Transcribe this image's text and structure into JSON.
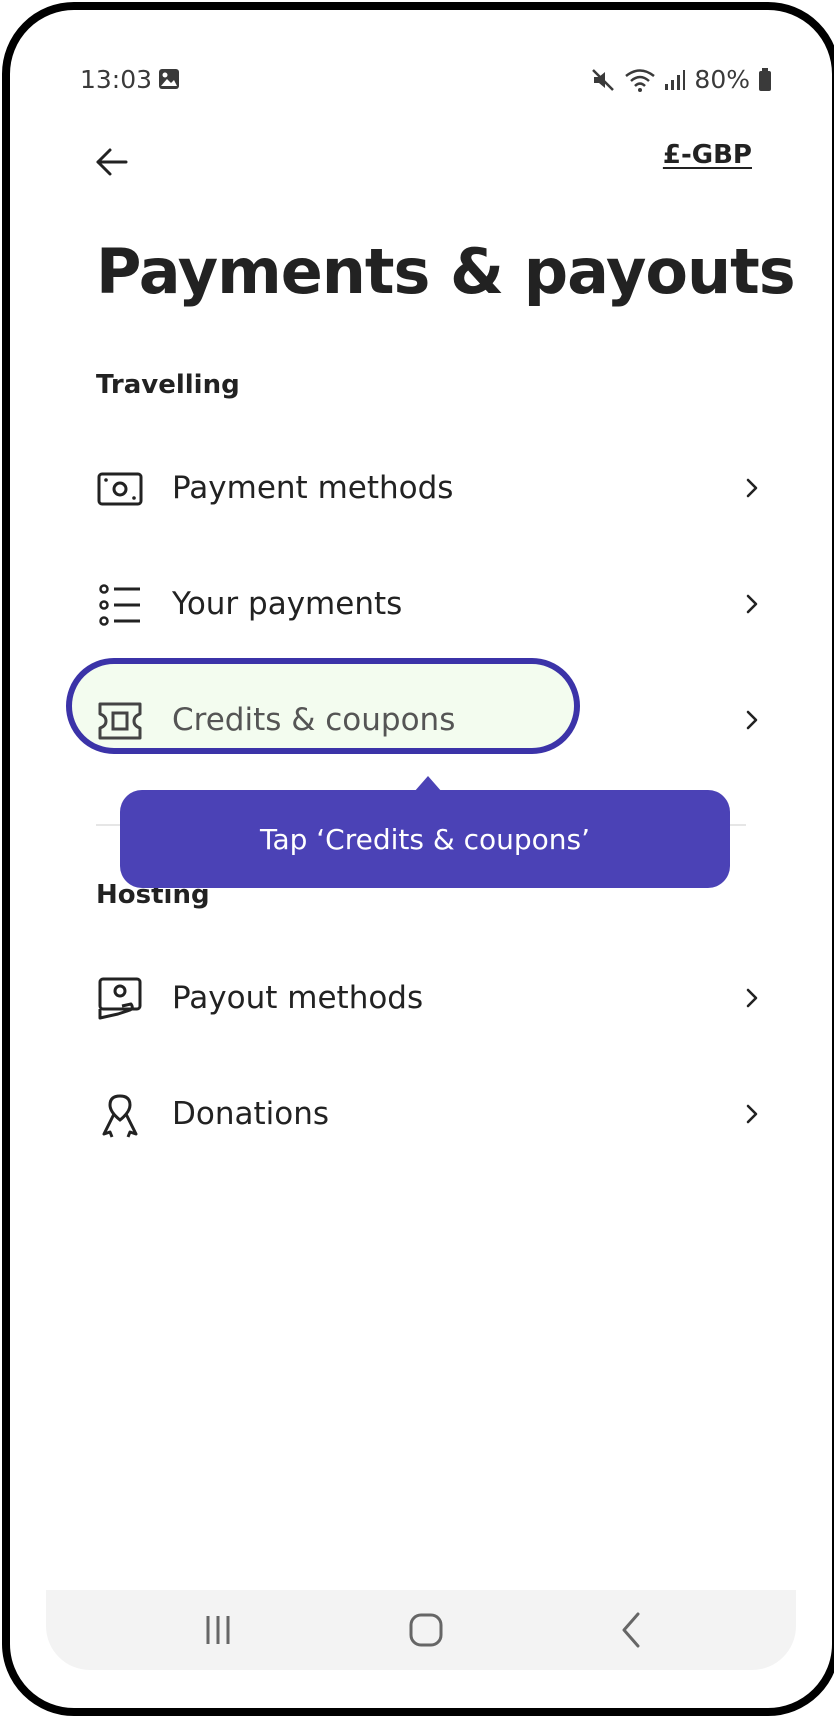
{
  "status_bar": {
    "time": "13:03",
    "battery": "80%"
  },
  "header": {
    "currency": "£-GBP"
  },
  "page": {
    "title": "Payments & payouts"
  },
  "sections": {
    "travelling": {
      "label": "Travelling",
      "items": [
        {
          "label": "Payment methods",
          "icon": "banknote-icon"
        },
        {
          "label": "Your payments",
          "icon": "list-icon"
        },
        {
          "label": "Credits & coupons",
          "icon": "ticket-icon"
        }
      ]
    },
    "hosting": {
      "label": "Hosting",
      "items": [
        {
          "label": "Payout methods",
          "icon": "hand-cash-icon"
        },
        {
          "label": "Donations",
          "icon": "ribbon-icon"
        }
      ]
    }
  },
  "tooltip": {
    "text": "Tap ‘Credits & coupons’"
  },
  "colors": {
    "accent": "#4b42b6",
    "ring": "#3b33a8",
    "highlight_bg": "#f3fcef"
  }
}
